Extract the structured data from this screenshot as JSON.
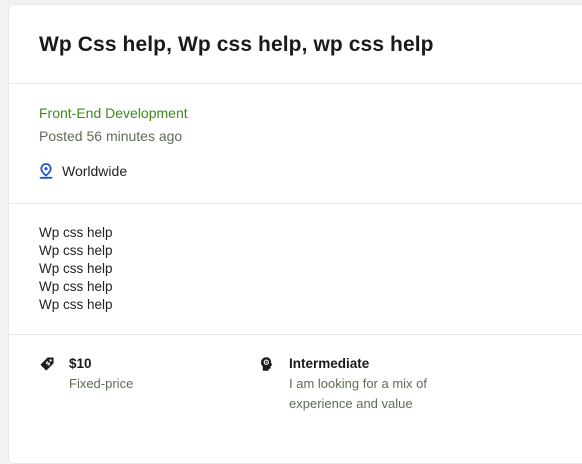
{
  "job": {
    "title": "Wp Css help, Wp css help, wp css help",
    "category": "Front-End Development",
    "posted": "Posted 56 minutes ago",
    "location": "Worldwide",
    "description_lines": [
      "Wp css help",
      "Wp css help",
      "Wp css help",
      "Wp css help",
      "Wp css help"
    ],
    "budget": {
      "value": "$10",
      "label": "Fixed-price",
      "icon": "price-tag-icon"
    },
    "experience": {
      "value": "Intermediate",
      "label": "I am looking for a mix of experience and value",
      "icon": "expertise-head-icon"
    }
  },
  "colors": {
    "accent_green": "#3d8a1d",
    "location_icon_blue": "#1f57c3",
    "muted_text": "#5e6d55"
  }
}
